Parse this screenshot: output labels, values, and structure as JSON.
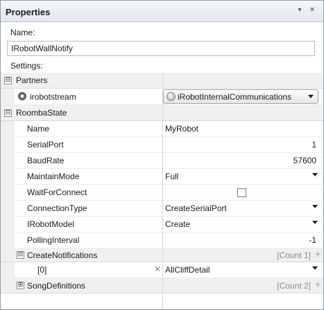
{
  "panel": {
    "title": "Properties"
  },
  "name_label": "Name:",
  "name_value": "IRobotWallNotify",
  "settings_label": "Settings:",
  "grid": {
    "partners": {
      "label": "Partners",
      "expander": "⊟",
      "items": [
        {
          "key": "irobotstream",
          "value": "iRobotInternalCommunications"
        }
      ]
    },
    "roomba_state": {
      "label": "RoombaState",
      "expander": "⊟",
      "props": {
        "name": {
          "key": "Name",
          "value": "MyRobot"
        },
        "serial_port": {
          "key": "SerialPort",
          "value": "1"
        },
        "baud_rate": {
          "key": "BaudRate",
          "value": "57600"
        },
        "maintain_mode": {
          "key": "MaintainMode",
          "value": "Full"
        },
        "wait_for_connect": {
          "key": "WaitForConnect",
          "checked": false
        },
        "connection_type": {
          "key": "ConnectionType",
          "value": "CreateSerialPort"
        },
        "irobot_model": {
          "key": "IRobotModel",
          "value": "Create"
        },
        "polling_interval": {
          "key": "PollingInterval",
          "value": "-1"
        }
      },
      "create_notifications": {
        "key": "CreateNotifications",
        "expander": "⊟",
        "count": "[Count 1]",
        "items": [
          {
            "index": "[0]",
            "value": "AllCliffDetail"
          }
        ]
      },
      "song_definitions": {
        "key": "SongDefinitions",
        "expander": "⊞",
        "count": "[Count 2]"
      }
    }
  },
  "icons": {
    "pin": "▾",
    "close": "✕",
    "plus": "+",
    "remove": "✕"
  },
  "colors": {
    "category_bg": "#f0f0f0",
    "title_gradient_top": "#f7f8fa",
    "title_gradient_bottom": "#e2e6ec",
    "count_text": "#8a8a8a"
  }
}
